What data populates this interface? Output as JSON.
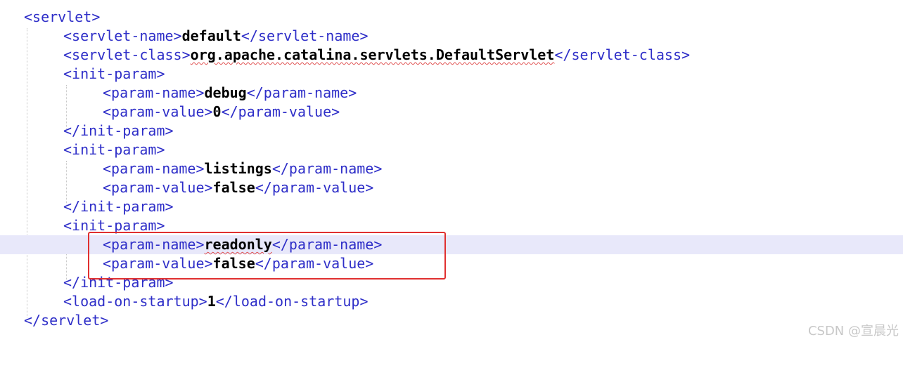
{
  "editor": {
    "lines": [
      {
        "open": "<servlet>",
        "text": "",
        "close": ""
      },
      {
        "open": "<servlet-name>",
        "text": "default",
        "close": "</servlet-name>"
      },
      {
        "open": "<servlet-class>",
        "text": "org.apache.catalina.servlets.DefaultServlet",
        "close": "</servlet-class>"
      },
      {
        "open": "<init-param>",
        "text": "",
        "close": ""
      },
      {
        "open": "<param-name>",
        "text": "debug",
        "close": "</param-name>"
      },
      {
        "open": "<param-value>",
        "text": "0",
        "close": "</param-value>"
      },
      {
        "open": "</init-param>",
        "text": "",
        "close": ""
      },
      {
        "open": "<init-param>",
        "text": "",
        "close": ""
      },
      {
        "open": "<param-name>",
        "text": "listings",
        "close": "</param-name>"
      },
      {
        "open": "<param-value>",
        "text": "false",
        "close": "</param-value>"
      },
      {
        "open": "</init-param>",
        "text": "",
        "close": ""
      },
      {
        "open": "<init-param>",
        "text": "",
        "close": ""
      },
      {
        "open": "<param-name>",
        "text": "readonly",
        "close": "</param-name>"
      },
      {
        "open": "<param-value>",
        "text": "false",
        "close": "</param-value>"
      },
      {
        "open": "</init-param>",
        "text": "",
        "close": ""
      },
      {
        "open": "<load-on-startup>",
        "text": "1",
        "close": "</load-on-startup>"
      },
      {
        "open": "</servlet>",
        "text": "",
        "close": ""
      }
    ]
  },
  "watermark": "CSDN @宣晨光",
  "colors": {
    "tag": "#2e2ec8",
    "text": "#000000",
    "current_line": "#e8e8fa",
    "highlight_border": "#e03030"
  }
}
